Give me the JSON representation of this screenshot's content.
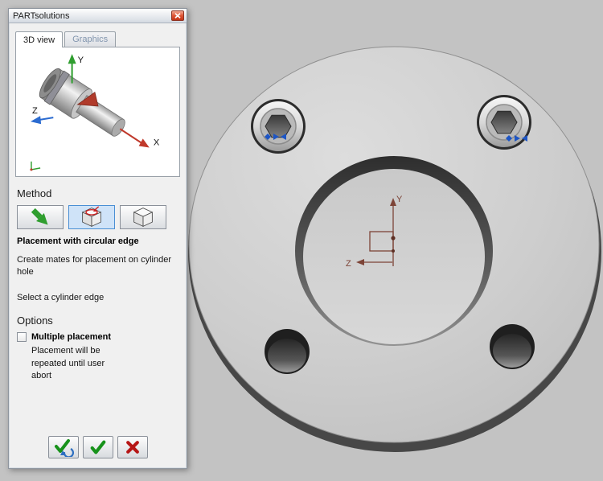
{
  "window": {
    "title": "PARTsolutions"
  },
  "tabs": [
    {
      "label": "3D view",
      "active": true
    },
    {
      "label": "Graphics",
      "active": false
    }
  ],
  "preview": {
    "axis_x": "X",
    "axis_y": "Y",
    "axis_z": "Z"
  },
  "method": {
    "heading": "Method",
    "buttons": [
      {
        "name": "placement-free",
        "icon": "green-arrow-icon",
        "selected": false
      },
      {
        "name": "placement-with-circular-edge",
        "icon": "cube-circular-edge-icon",
        "selected": true
      },
      {
        "name": "placement-with-box",
        "icon": "cube-icon",
        "selected": false
      }
    ],
    "selected_title": "Placement with circular edge",
    "description": "Create mates for placement on cylinder hole",
    "hint": "Select a cylinder edge"
  },
  "options": {
    "heading": "Options",
    "multiple_placement": {
      "label": "Multiple placement",
      "checked": false,
      "description": "Placement will be repeated until user abort"
    }
  },
  "actions": [
    {
      "name": "apply-and-repeat",
      "icon": "check-repeat-icon"
    },
    {
      "name": "apply",
      "icon": "check-icon"
    },
    {
      "name": "cancel",
      "icon": "cross-icon"
    }
  ],
  "viewport": {
    "sketch_axis_y": "Y",
    "sketch_axis_z": "Z"
  },
  "colors": {
    "viewport_background": "#c3c3c3",
    "accent_green": "#2f9e2f",
    "accent_red": "#b61616",
    "selection_blue": "#1d55c4"
  }
}
